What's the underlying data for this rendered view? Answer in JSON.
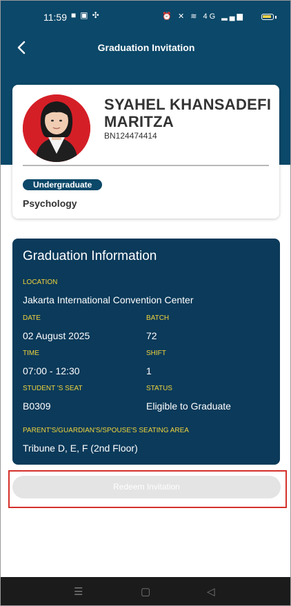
{
  "status_bar": {
    "time": "11:59",
    "left_icons": [
      "notification-bag-icon",
      "notification-app-icon",
      "notification-fan-icon"
    ],
    "right_icons": [
      "alarm-icon",
      "mute-icon",
      "wifi-icon",
      "signal-icon",
      "battery-icon"
    ],
    "network_label": "4G"
  },
  "header": {
    "title": "Graduation Invitation",
    "back_icon": "chevron-left-icon"
  },
  "profile": {
    "name": "SYAHEL KHANSADEFI MARITZA",
    "student_id": "BN124474414",
    "degree": "Undergraduate",
    "major": "Psychology",
    "avatar_bg": "#d51f27"
  },
  "graduation_info": {
    "title": "Graduation Information",
    "location_label": "LOCATION",
    "location": "Jakarta International Convention Center",
    "date_label": "DATE",
    "date": "02 August 2025",
    "batch_label": "BATCH",
    "batch": "72",
    "time_label": "TIME",
    "time": "07:00 - 12:30",
    "shift_label": "SHIFT",
    "shift": "1",
    "seat_label": "STUDENT 'S SEAT",
    "seat": "B0309",
    "status_label": "STATUS",
    "status": "Eligible to Graduate",
    "seating_area_label": "PARENT'S/GUARDIAN'S/SPOUSE'S SEATING AREA",
    "seating_area": "Tribune D, E, F (2nd Floor)"
  },
  "actions": {
    "redeem_label": "Redeem Invitation",
    "redeem_enabled": false
  },
  "colors": {
    "primary": "#0b4869",
    "card_dark": "#0b3a5a",
    "label_yellow": "#f0d43c",
    "highlight_red": "#d4302a"
  }
}
